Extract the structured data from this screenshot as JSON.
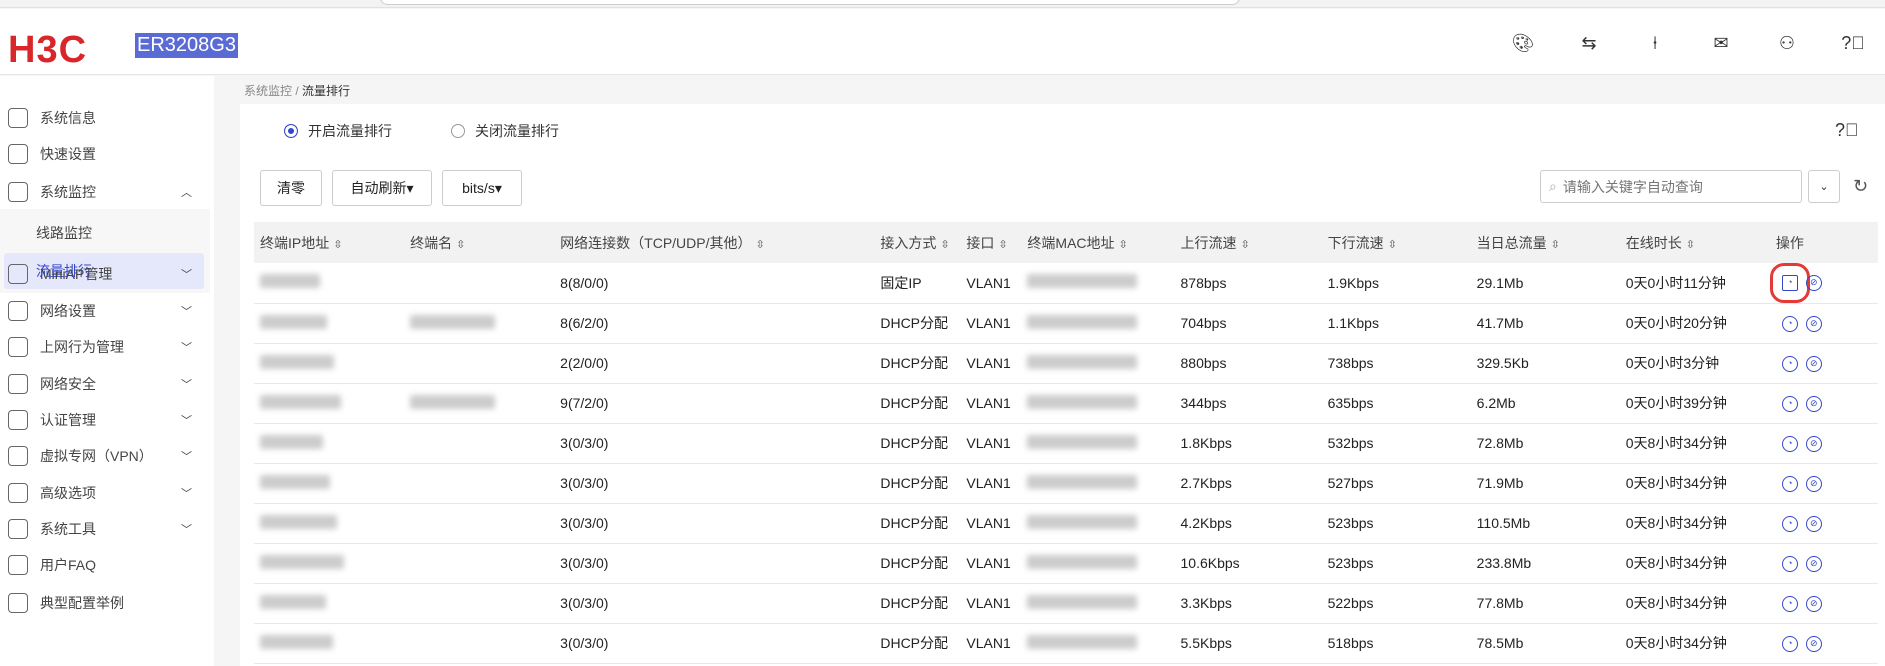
{
  "header": {
    "logo": "H3C",
    "model": "ER3208G3"
  },
  "header_icons": [
    "palette-icon",
    "language-icon",
    "guide-icon",
    "message-icon",
    "user-icon",
    "help-icon"
  ],
  "sidebar": {
    "items": [
      {
        "label": "系统信息",
        "icon": "system-info-icon"
      },
      {
        "label": "快速设置",
        "icon": "quick-setup-icon"
      },
      {
        "label": "系统监控",
        "icon": "system-monitor-icon",
        "expanded": true,
        "children": [
          {
            "label": "线路监控"
          },
          {
            "label": "流量排行",
            "active": true
          }
        ]
      },
      {
        "label": "MiniAP管理",
        "icon": "miniap-icon"
      },
      {
        "label": "网络设置",
        "icon": "network-settings-icon"
      },
      {
        "label": "上网行为管理",
        "icon": "behavior-icon"
      },
      {
        "label": "网络安全",
        "icon": "security-icon"
      },
      {
        "label": "认证管理",
        "icon": "auth-icon"
      },
      {
        "label": "虚拟专网（VPN）",
        "icon": "vpn-icon"
      },
      {
        "label": "高级选项",
        "icon": "advanced-icon"
      },
      {
        "label": "系统工具",
        "icon": "tools-icon"
      },
      {
        "label": "用户FAQ",
        "icon": "faq-icon"
      },
      {
        "label": "典型配置举例",
        "icon": "example-icon"
      }
    ]
  },
  "breadcrumb": {
    "parent": "系统监控",
    "sep": " / ",
    "current": "流量排行"
  },
  "radios": {
    "on": "开启流量排行",
    "off": "关闭流量排行"
  },
  "toolbar": {
    "clear": "清零",
    "auto_refresh": "自动刷新▾",
    "unit": "bits/s▾",
    "search_placeholder": "请输入关键字自动查询"
  },
  "table": {
    "columns": [
      "终端IP地址",
      "终端名",
      "网络连接数（TCP/UDP/其他）",
      "接入方式",
      "接口",
      "终端MAC地址",
      "上行流速",
      "下行流速",
      "当日总流量",
      "在线时长",
      "操作"
    ],
    "rows": [
      {
        "conn": "8(8/0/0)",
        "access": "固定IP",
        "iface": "VLAN1",
        "up": "878bps",
        "down": "1.9Kbps",
        "total": "29.1Mb",
        "online": "0天0小时11分钟",
        "name": false
      },
      {
        "conn": "8(6/2/0)",
        "access": "DHCP分配",
        "iface": "VLAN1",
        "up": "704bps",
        "down": "1.1Kbps",
        "total": "41.7Mb",
        "online": "0天0小时20分钟",
        "name": true
      },
      {
        "conn": "2(2/0/0)",
        "access": "DHCP分配",
        "iface": "VLAN1",
        "up": "880bps",
        "down": "738bps",
        "total": "329.5Kb",
        "online": "0天0小时3分钟",
        "name": false
      },
      {
        "conn": "9(7/2/0)",
        "access": "DHCP分配",
        "iface": "VLAN1",
        "up": "344bps",
        "down": "635bps",
        "total": "6.2Mb",
        "online": "0天0小时39分钟",
        "name": true
      },
      {
        "conn": "3(0/3/0)",
        "access": "DHCP分配",
        "iface": "VLAN1",
        "up": "1.8Kbps",
        "down": "532bps",
        "total": "72.8Mb",
        "online": "0天8小时34分钟",
        "name": false
      },
      {
        "conn": "3(0/3/0)",
        "access": "DHCP分配",
        "iface": "VLAN1",
        "up": "2.7Kbps",
        "down": "527bps",
        "total": "71.9Mb",
        "online": "0天8小时34分钟",
        "name": false
      },
      {
        "conn": "3(0/3/0)",
        "access": "DHCP分配",
        "iface": "VLAN1",
        "up": "4.2Kbps",
        "down": "523bps",
        "total": "110.5Mb",
        "online": "0天8小时34分钟",
        "name": false
      },
      {
        "conn": "3(0/3/0)",
        "access": "DHCP分配",
        "iface": "VLAN1",
        "up": "10.6Kbps",
        "down": "523bps",
        "total": "233.8Mb",
        "online": "0天8小时34分钟",
        "name": false
      },
      {
        "conn": "3(0/3/0)",
        "access": "DHCP分配",
        "iface": "VLAN1",
        "up": "3.3Kbps",
        "down": "522bps",
        "total": "77.8Mb",
        "online": "0天8小时34分钟",
        "name": false
      },
      {
        "conn": "3(0/3/0)",
        "access": "DHCP分配",
        "iface": "VLAN1",
        "up": "5.5Kbps",
        "down": "518bps",
        "total": "78.5Mb",
        "online": "0天8小时34分钟",
        "name": false
      }
    ]
  },
  "colors": {
    "accent": "#3447c9",
    "brand": "#d9262a",
    "highlight": "#e53935"
  }
}
